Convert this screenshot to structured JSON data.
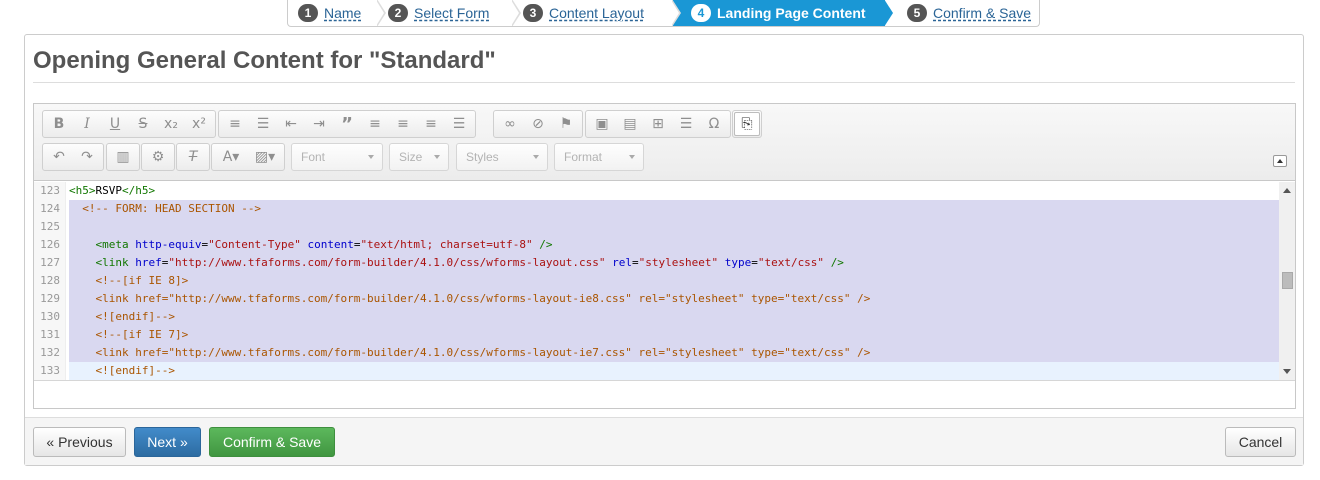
{
  "wizard": {
    "steps": [
      {
        "num": "1",
        "label": "Name"
      },
      {
        "num": "2",
        "label": "Select Form"
      },
      {
        "num": "3",
        "label": "Content Layout"
      },
      {
        "num": "4",
        "label": "Landing Page Content",
        "active": true
      },
      {
        "num": "5",
        "label": "Confirm & Save"
      }
    ]
  },
  "page": {
    "title": "Opening General Content for \"Standard\""
  },
  "toolbar": {
    "row1_groups": [
      [
        "bold-icon",
        "italic-icon",
        "underline-icon",
        "strikethrough-icon",
        "subscript-icon",
        "superscript-icon"
      ],
      [
        "numbered-list-icon",
        "bulleted-list-icon",
        "outdent-icon",
        "indent-icon",
        "blockquote-icon",
        "align-left-icon",
        "align-center-icon",
        "align-right-icon",
        "justify-icon"
      ],
      [
        "link-icon",
        "unlink-icon",
        "anchor-icon"
      ],
      [
        "image-icon",
        "flash-icon",
        "table-icon",
        "horizontal-rule-icon",
        "special-char-icon"
      ]
    ],
    "source_icon": "source-icon",
    "row2_groups": [
      [
        "undo-icon",
        "redo-icon"
      ],
      [
        "paste-icon"
      ],
      [
        "settings-icon"
      ],
      [
        "remove-format-icon"
      ],
      [
        "text-color-icon",
        "bg-color-icon"
      ]
    ],
    "combos": {
      "font": "Font",
      "size": "Size",
      "styles": "Styles",
      "format": "Format"
    }
  },
  "code": {
    "lines": [
      {
        "n": "123",
        "indent": "",
        "tokens": [
          [
            "tag",
            "<h5>"
          ],
          [
            "pl",
            "RSVP"
          ],
          [
            "tag",
            "</h5>"
          ]
        ],
        "state": "none"
      },
      {
        "n": "124",
        "indent": "  ",
        "tokens": [
          [
            "cm",
            "<!-- FORM: HEAD SECTION -->"
          ]
        ],
        "state": "sel"
      },
      {
        "n": "125",
        "indent": "",
        "tokens": [],
        "state": "sel"
      },
      {
        "n": "126",
        "indent": "    ",
        "tokens": [
          [
            "tag",
            "<meta "
          ],
          [
            "attr",
            "http-equiv"
          ],
          [
            "pl",
            "="
          ],
          [
            "val",
            "\"Content-Type\""
          ],
          [
            "pl",
            " "
          ],
          [
            "attr",
            "content"
          ],
          [
            "pl",
            "="
          ],
          [
            "val",
            "\"text/html; charset=utf-8\""
          ],
          [
            "pl",
            " "
          ],
          [
            "tag",
            "/>"
          ]
        ],
        "state": "sel"
      },
      {
        "n": "127",
        "indent": "    ",
        "tokens": [
          [
            "tag",
            "<link "
          ],
          [
            "attr",
            "href"
          ],
          [
            "pl",
            "="
          ],
          [
            "val",
            "\"http://www.tfaforms.com/form-builder/4.1.0/css/wforms-layout.css\""
          ],
          [
            "pl",
            " "
          ],
          [
            "attr",
            "rel"
          ],
          [
            "pl",
            "="
          ],
          [
            "val",
            "\"stylesheet\""
          ],
          [
            "pl",
            " "
          ],
          [
            "attr",
            "type"
          ],
          [
            "pl",
            "="
          ],
          [
            "val",
            "\"text/css\""
          ],
          [
            "pl",
            " "
          ],
          [
            "tag",
            "/>"
          ]
        ],
        "state": "sel"
      },
      {
        "n": "128",
        "indent": "    ",
        "tokens": [
          [
            "cm",
            "<!--[if IE 8]>"
          ]
        ],
        "state": "sel"
      },
      {
        "n": "129",
        "indent": "    ",
        "tokens": [
          [
            "cm",
            "<link href=\"http://www.tfaforms.com/form-builder/4.1.0/css/wforms-layout-ie8.css\" rel=\"stylesheet\" type=\"text/css\" />"
          ]
        ],
        "state": "sel"
      },
      {
        "n": "130",
        "indent": "    ",
        "tokens": [
          [
            "cm",
            "<![endif]-->"
          ]
        ],
        "state": "sel"
      },
      {
        "n": "131",
        "indent": "    ",
        "tokens": [
          [
            "cm",
            "<!--[if IE 7]>"
          ]
        ],
        "state": "sel"
      },
      {
        "n": "132",
        "indent": "    ",
        "tokens": [
          [
            "cm",
            "<link href=\"http://www.tfaforms.com/form-builder/4.1.0/css/wforms-layout-ie7.css\" rel=\"stylesheet\" type=\"text/css\" />"
          ]
        ],
        "state": "sel"
      },
      {
        "n": "133",
        "indent": "    ",
        "tokens": [
          [
            "cm",
            "<![endif]-->"
          ]
        ],
        "state": "cur"
      }
    ]
  },
  "footer": {
    "previous_label": "« Previous",
    "next_label": "Next »",
    "confirm_label": "Confirm & Save",
    "cancel_label": "Cancel"
  },
  "colors": {
    "active_step": "#1a97d5",
    "primary": "#428bca",
    "success": "#5cb85c",
    "selection": "#d9d8f0"
  }
}
